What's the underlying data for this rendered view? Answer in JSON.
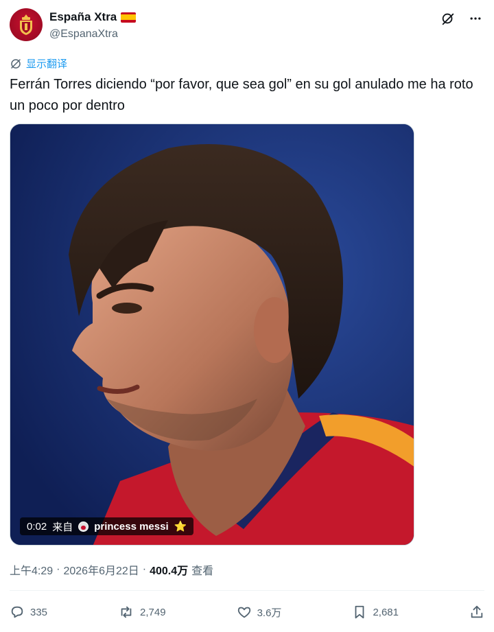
{
  "author": {
    "display_name": "España Xtra",
    "handle": "@EspanaXtra",
    "flag_icon": "spain-flag-icon"
  },
  "header": {
    "grok_icon": "grok-icon",
    "more_icon": "more-dots-icon"
  },
  "translate": {
    "label": "显示翻译",
    "icon": "translate-icon"
  },
  "tweet": {
    "text": "Ferrán Torres diciendo “por favor, que sea gol” en su gol anulado me ha roto un poco por dentro"
  },
  "media": {
    "type": "video",
    "duration": "0:02",
    "from_label": "来自",
    "source_user": "princess messi",
    "source_emoji": "⭐"
  },
  "meta": {
    "time": "上午4:29",
    "separator": "·",
    "date": "2026年6月22日",
    "views_count": "400.4万",
    "views_label": "查看"
  },
  "actions": {
    "replies": "335",
    "reposts": "2,749",
    "likes": "3.6万",
    "bookmarks": "2,681"
  },
  "colors": {
    "accent": "#1d9bf0",
    "text": "#0f1419",
    "secondary": "#536471",
    "brand_red": "#c8102e"
  }
}
